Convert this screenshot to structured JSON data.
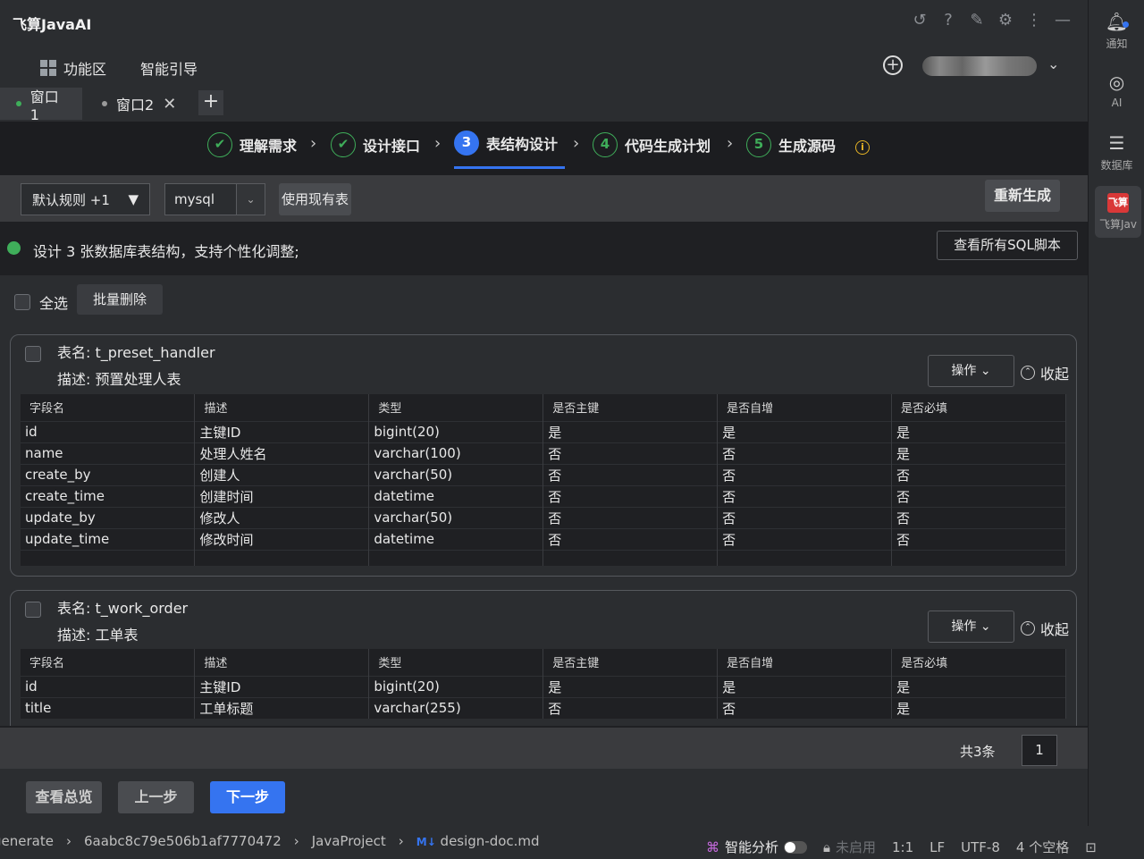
{
  "app": {
    "title": "飞算JavaAI"
  },
  "menu": {
    "workspace": "功能区",
    "guide": "智能引导"
  },
  "tabs": [
    {
      "label": "窗口1",
      "active": true,
      "dot_color": "#3fae5a"
    },
    {
      "label": "窗口2",
      "active": false,
      "dot_color": "#9a9a9a"
    }
  ],
  "steps": [
    {
      "index": "✔",
      "label": "理解需求"
    },
    {
      "index": "✔",
      "label": "设计接口"
    },
    {
      "index": "3",
      "label": "表结构设计"
    },
    {
      "index": "4",
      "label": "代码生成计划"
    },
    {
      "index": "5",
      "label": "生成源码"
    }
  ],
  "toolbar": {
    "rule_select": "默认规则 +1",
    "db_select": "mysql",
    "use_existing": "使用现有表",
    "regenerate": "重新生成"
  },
  "info": {
    "message": "设计 3 张数据库表结构，支持个性化调整;",
    "view_sql": "查看所有SQL脚本"
  },
  "list": {
    "select_all": "全选",
    "batch_delete": "批量删除"
  },
  "columns": [
    "字段名",
    "描述",
    "类型",
    "是否主键",
    "是否自增",
    "是否必填"
  ],
  "tables": [
    {
      "name": "表名: t_preset_handler",
      "desc": "描述: 预置处理人表",
      "ops": "操作",
      "fold": "收起",
      "rows": [
        [
          "id",
          "主键ID",
          "bigint(20)",
          "是",
          "是",
          "是"
        ],
        [
          "name",
          "处理人姓名",
          "varchar(100)",
          "否",
          "否",
          "是"
        ],
        [
          "create_by",
          "创建人",
          "varchar(50)",
          "否",
          "否",
          "否"
        ],
        [
          "create_time",
          "创建时间",
          "datetime",
          "否",
          "否",
          "否"
        ],
        [
          "update_by",
          "修改人",
          "varchar(50)",
          "否",
          "否",
          "否"
        ],
        [
          "update_time",
          "修改时间",
          "datetime",
          "否",
          "否",
          "否"
        ]
      ]
    },
    {
      "name": "表名: t_work_order",
      "desc": "描述: 工单表",
      "ops": "操作",
      "fold": "收起",
      "rows": [
        [
          "id",
          "主键ID",
          "bigint(20)",
          "是",
          "是",
          "是"
        ],
        [
          "title",
          "工单标题",
          "varchar(255)",
          "否",
          "否",
          "是"
        ]
      ]
    }
  ],
  "pager": {
    "total": "共3条",
    "page": "1"
  },
  "actions": {
    "overview": "查看总览",
    "prev": "上一步",
    "next": "下一步"
  },
  "statusbar": {
    "crumbs": [
      "generate",
      "6aabc8c79e506b1af7770472",
      "JavaProject",
      "design-doc.md"
    ],
    "md_badge": "M↓",
    "analysis": "智能分析",
    "disabled": "未启用",
    "zoom": "1:1",
    "eol": "LF",
    "encoding": "UTF-8",
    "indent": "4 个空格"
  },
  "sidebar": {
    "notify": "通知",
    "ai": "AI",
    "database": "数据库",
    "brand": "飞算Jav",
    "brand_badge": "飞算"
  },
  "colors": {
    "accent": "#3574f0",
    "success": "#3fae5a",
    "warning": "#e5b325",
    "brand": "#d93838"
  }
}
